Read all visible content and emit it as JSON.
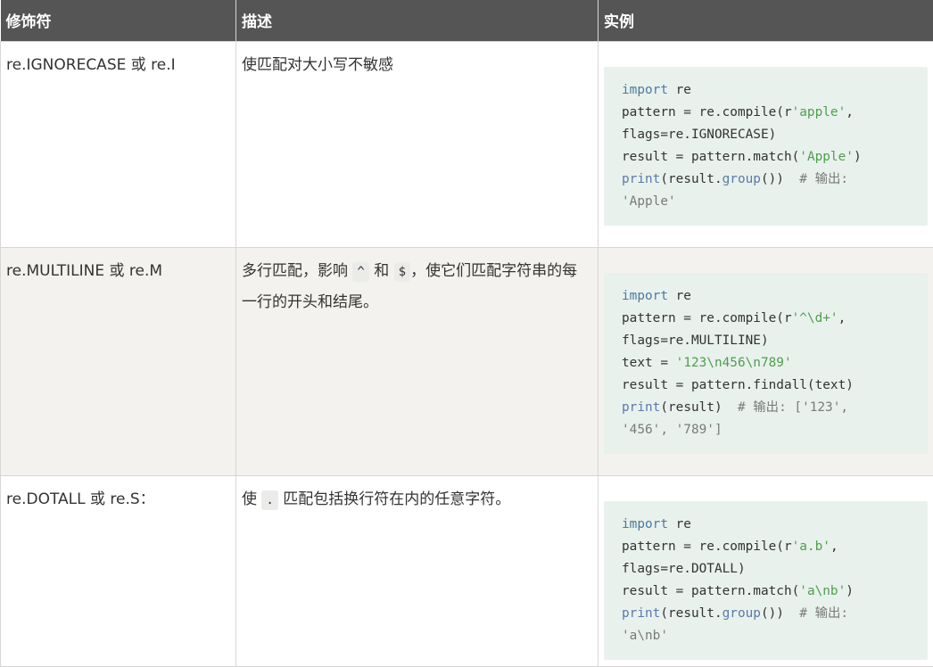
{
  "headers": {
    "flag": "修饰符",
    "description": "描述",
    "example": "实例"
  },
  "rows": [
    {
      "flag": "re.IGNORECASE 或 re.I",
      "description": "使匹配对大小写不敏感",
      "code": {
        "l1_kw": "import",
        "l1_rest": " re",
        "l2_a": "pattern = re.compile(r",
        "l2_str": "'apple'",
        "l2_b": ",",
        "l3": "flags=re.IGNORECASE)",
        "l4_a": "result = pattern.match(",
        "l4_str": "'Apple'",
        "l4_b": ")",
        "l5_fn": "print",
        "l5_a": "(result.",
        "l5_fn2": "group",
        "l5_b": "())  ",
        "l5_cm": "# 输出:",
        "l6_cm": "'Apple'"
      }
    },
    {
      "flag": "re.MULTILINE 或 re.M",
      "description_a": "多行匹配，影响 ",
      "description_code1": "^",
      "description_b": " 和 ",
      "description_code2": "$",
      "description_c": "，使它们匹配字符串的每一行的开头和结尾。",
      "code": {
        "l1_kw": "import",
        "l1_rest": " re",
        "l2_a": "pattern = re.compile(r",
        "l2_str": "'^\\d+'",
        "l2_b": ",",
        "l3": "flags=re.MULTILINE)",
        "l4_a": "text = ",
        "l4_str": "'123\\n456\\n789'",
        "l5": "result = pattern.findall(text)",
        "l6_fn": "print",
        "l6_a": "(result)  ",
        "l6_cm": "# 输出: ['123',",
        "l7_cm": "'456', '789']"
      }
    },
    {
      "flag": "re.DOTALL 或 re.S：",
      "description_a": "使 ",
      "description_code": ".",
      "description_b": " 匹配包括换行符在内的任意字符。",
      "code": {
        "l1_kw": "import",
        "l1_rest": " re",
        "l2_a": "pattern = re.compile(r",
        "l2_str": "'a.b'",
        "l2_b": ",",
        "l3": "flags=re.DOTALL)",
        "l4_a": "result = pattern.match(",
        "l4_str": "'a\\nb'",
        "l4_b": ")",
        "l5_fn": "print",
        "l5_a": "(result.",
        "l5_fn2": "group",
        "l5_b": "())  ",
        "l5_cm": "# 输出:",
        "l6_cm": "'a\\nb'"
      }
    }
  ]
}
